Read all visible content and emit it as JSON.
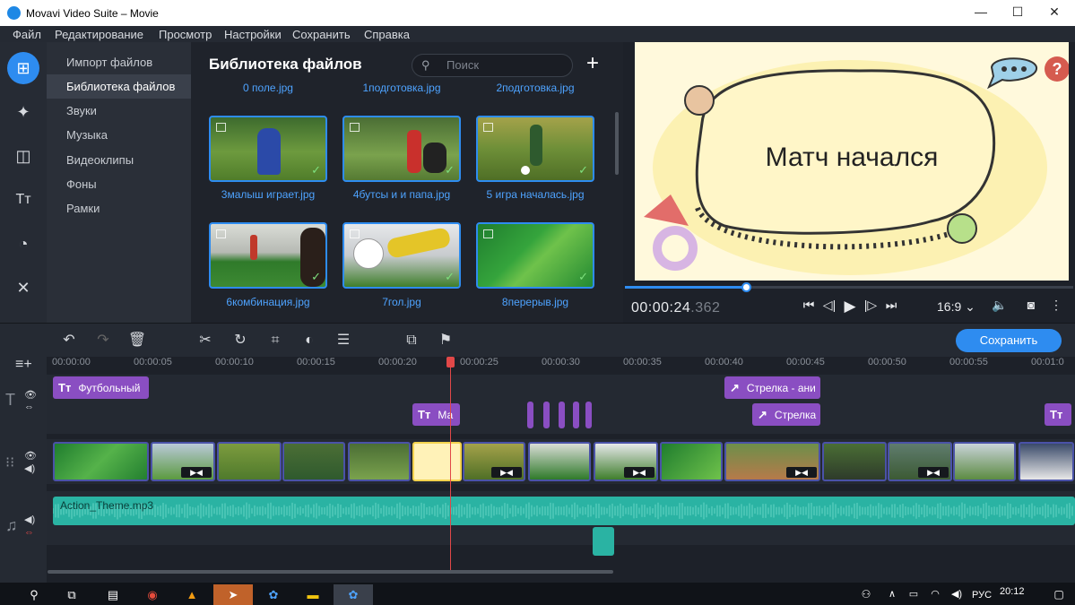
{
  "window": {
    "title": "Movavi Video Suite – Movie"
  },
  "menu": [
    "Файл",
    "Редактирование",
    "Просмотр",
    "Настройки",
    "Сохранить",
    "Справка"
  ],
  "categories": [
    "Импорт файлов",
    "Библиотека файлов",
    "Звуки",
    "Музыка",
    "Видеоклипы",
    "Фоны",
    "Рамки"
  ],
  "library": {
    "title": "Библиотека файлов",
    "search_placeholder": "Поиск",
    "top_row": [
      "0 поле.jpg",
      "1подготовка.jpg",
      "2подготовка.jpg"
    ],
    "row1": [
      "3малыш играет.jpg",
      "4бутсы и и папа.jpg",
      "5 игра началась.jpg"
    ],
    "row2": [
      "6комбинация.jpg",
      "7гол.jpg",
      "8перерыв.jpg"
    ]
  },
  "preview": {
    "text": "Матч начался",
    "help": "?",
    "time_main": "00:00:24",
    "time_ms": ".362",
    "ratio": "16:9",
    "progress": 0.27
  },
  "toolbar": {
    "save_label": "Сохранить"
  },
  "timeline": {
    "ticks": [
      "00:00:00",
      "00:00:05",
      "00:00:10",
      "00:00:15",
      "00:00:20",
      "00:00:25",
      "00:00:30",
      "00:00:35",
      "00:00:40",
      "00:00:45",
      "00:00:50",
      "00:00:55",
      "00:01:0"
    ],
    "title_clip_1": "Футбольный",
    "title_clip_2": "Ма",
    "arrow_clip_1": "Стрелка - ани",
    "arrow_clip_2": "Стрелка",
    "audio_clip": "Action_Theme.mp3"
  },
  "taskbar": {
    "lang": "РУС",
    "clock": "20:12"
  },
  "colors": {
    "accent": "#2e8cf0",
    "title_clip": "#8a4ec2",
    "audio": "#2ab3a3",
    "playhead": "#e14848"
  }
}
